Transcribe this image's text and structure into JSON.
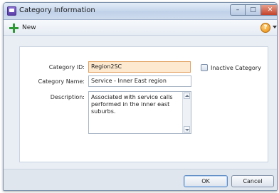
{
  "window": {
    "title": "Category Information",
    "minimize_glyph": "–",
    "maximize_glyph": "□",
    "close_glyph": "✕"
  },
  "toolbar": {
    "new_label": "New",
    "help_glyph": "?"
  },
  "form": {
    "category_id_label": "Category ID:",
    "category_id_value": "Region2SC",
    "category_name_label": "Category Name:",
    "category_name_value": "Service - Inner East region",
    "description_label": "Description:",
    "description_value": "Associated with service calls performed in the inner east suburbs.",
    "inactive_label": "Inactive Category",
    "inactive_checked": false
  },
  "footer": {
    "ok_label": "OK",
    "cancel_label": "Cancel"
  }
}
